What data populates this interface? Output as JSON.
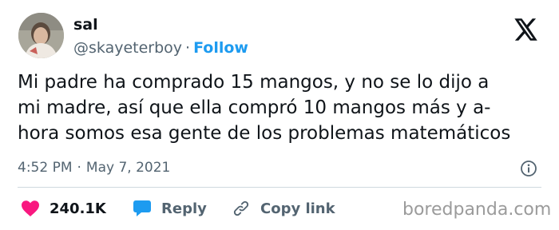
{
  "author": {
    "name": "sal",
    "handle": "@skayeterboy",
    "separator": "·",
    "follow_label": "Follow"
  },
  "tweet": {
    "lines": [
      "Mi padre ha comprado 15 mangos, y no se lo dijo a",
      "mi madre, así que ella compró 10 mangos más y a-",
      "hora somos esa gente de los problemas matemáticos"
    ],
    "time": "4:52 PM",
    "date_separator": "·",
    "date": "May 7, 2021"
  },
  "actions": {
    "likes_count": "240.1K",
    "reply_label": "Reply",
    "copy_link_label": "Copy link"
  },
  "watermark": "boredpanda.com",
  "icons": {
    "logo": "x-logo-icon",
    "info": "info-icon",
    "like": "heart-icon",
    "reply": "speech-bubble-icon",
    "copy": "link-icon"
  },
  "colors": {
    "accent": "#1d9bf0",
    "heart": "#f91880",
    "text": "#0f1419",
    "muted": "#536471",
    "divider": "#cfd9de"
  }
}
